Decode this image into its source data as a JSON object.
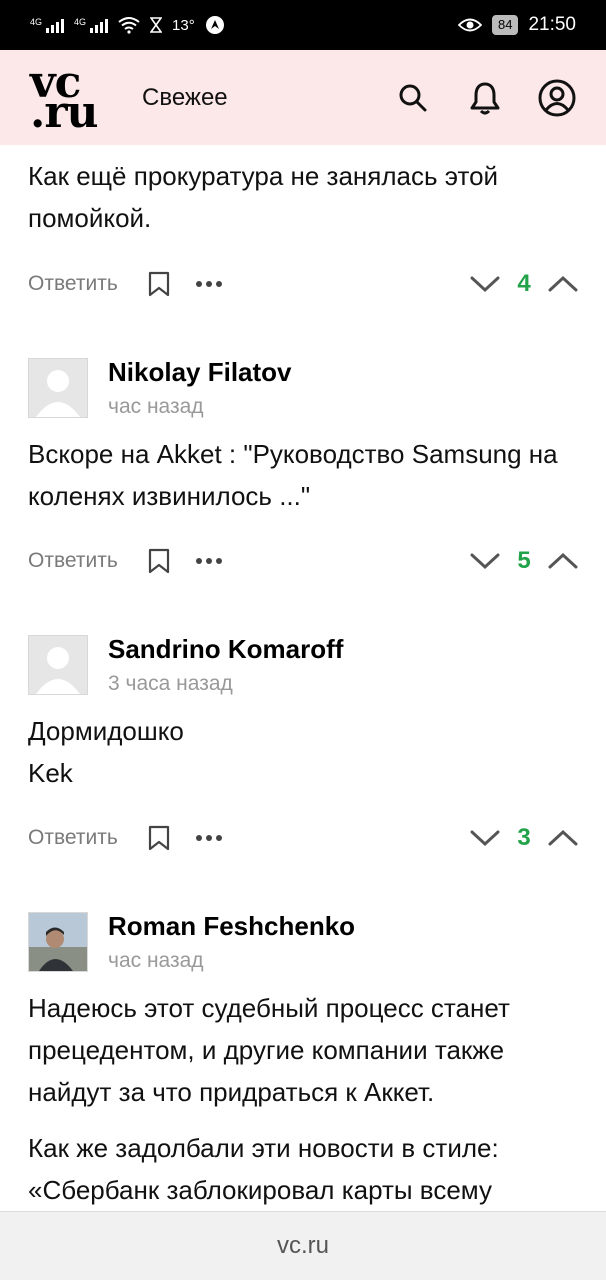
{
  "status_bar": {
    "network1": "4G",
    "network2": "4G",
    "temperature": "13°",
    "battery": "84",
    "time": "21:50"
  },
  "header": {
    "logo_line1": "vc",
    "logo_line2": ".ru",
    "section": "Свежее"
  },
  "comments": [
    {
      "text": [
        "Как ещё прокуратура не занялась этой помойкой."
      ],
      "reply_label": "Ответить",
      "score": "4"
    },
    {
      "author": "Nikolay Filatov",
      "time": "час назад",
      "text": [
        "Вскоре на Akket : \"Руководство Samsung на коленях извинилось ...\""
      ],
      "reply_label": "Ответить",
      "score": "5"
    },
    {
      "author": "Sandrino Komaroff",
      "time": "3 часа назад",
      "text": [
        "Дормидошко",
        "Kek"
      ],
      "reply_label": "Ответить",
      "score": "3"
    },
    {
      "author": "Roman Feshchenko",
      "time": "час назад",
      "text": [
        "Надеюсь этот судебный процесс станет прецедентом, и другие компании также найдут за что придраться к Аккет.",
        "Как же задолбали эти новости в стиле: «Сбербанк заблокировал карты всему"
      ]
    }
  ],
  "footer": {
    "domain": "vc.ru"
  },
  "colors": {
    "header_bg": "#fce8e8",
    "score": "#22a34a"
  }
}
